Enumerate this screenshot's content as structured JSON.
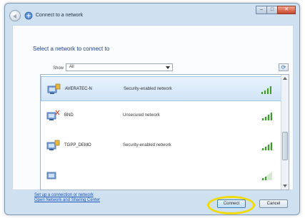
{
  "window": {
    "title": "Connect to a network",
    "caption": {
      "minimize": "–",
      "maximize": "□",
      "close": "✕"
    }
  },
  "main": {
    "heading": "Select a network to connect to",
    "show_label": "Show",
    "show_value": "All",
    "refresh_icon": "refresh-icon"
  },
  "networks": [
    {
      "ssid": "AVERATEC-N",
      "security": "Security-enabled network",
      "icon": "wireless-secured-icon",
      "signal": "signal-strength-icon",
      "selected": true
    },
    {
      "ssid": "BND",
      "security": "Unsecured network",
      "icon": "wireless-unsecured-icon",
      "signal": "signal-strength-icon",
      "selected": false
    },
    {
      "ssid": "TGPP_DEMO",
      "security": "Security-enabled network",
      "icon": "wireless-secured-icon",
      "signal": "signal-strength-icon",
      "selected": false
    },
    {
      "ssid": "",
      "security": "",
      "icon": "wireless-icon",
      "signal": "signal-strength-icon",
      "selected": false
    }
  ],
  "links": {
    "setup": "Set up a connection or network",
    "open_center": "Open Network and Sharing Center"
  },
  "buttons": {
    "connect": "Connect",
    "cancel": "Cancel"
  },
  "colors": {
    "highlight": "#f1da00",
    "link": "#1b54b8",
    "heading": "#1e3f8a"
  }
}
